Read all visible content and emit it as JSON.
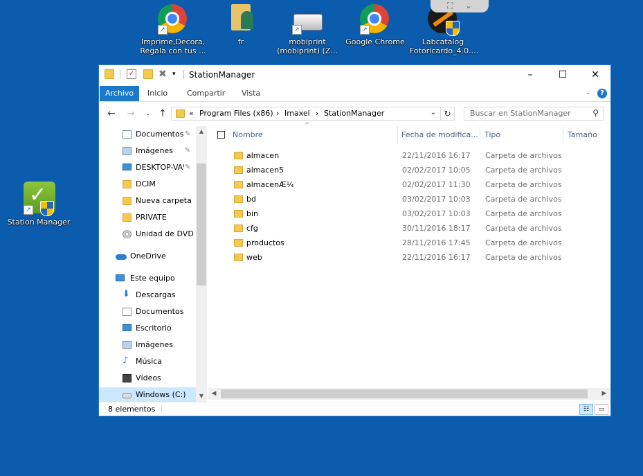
{
  "colors": {
    "desktop_bg": "#0b5cad",
    "accent": "#1979ca",
    "selection": "#cce8ff"
  },
  "desktop_icons": [
    {
      "label": "Imprime,Decora, Regala con tus ...",
      "icon": "chrome-icon"
    },
    {
      "label": "fr",
      "icon": "user-folder-icon"
    },
    {
      "label": "mobiprint (mobiprint) (Z...",
      "icon": "network-drive-icon"
    },
    {
      "label": "Google Chrome",
      "icon": "chrome-icon"
    },
    {
      "label": "Labcatalog Fotoricardo_4.0....",
      "icon": "labcatalog-icon"
    },
    {
      "label": "Station Manager",
      "icon": "station-manager-icon"
    }
  ],
  "window": {
    "title": "StationManager",
    "controls": {
      "minimize": "–",
      "maximize": "☐",
      "close": "✕"
    },
    "ribbon_tabs": [
      "Archivo",
      "Inicio",
      "Compartir",
      "Vista"
    ],
    "address": {
      "overflow": "«",
      "segments": [
        "Program Files (x86)",
        "Imaxel",
        "StationManager"
      ],
      "separator": "›"
    },
    "search_placeholder": "Buscar en StationManager",
    "nav_items": [
      {
        "label": "Documentos",
        "icon": "documents-icon",
        "pinned": true
      },
      {
        "label": "Imágenes",
        "icon": "pictures-icon",
        "pinned": true
      },
      {
        "label": "DESKTOP-VA\\",
        "icon": "computer-icon",
        "pinned": true
      },
      {
        "label": "DCIM",
        "icon": "folder-icon",
        "pinned": false
      },
      {
        "label": "Nueva carpeta",
        "icon": "folder-icon",
        "pinned": false
      },
      {
        "label": "PRIVATE",
        "icon": "folder-icon",
        "pinned": false
      },
      {
        "label": "Unidad de DVD R",
        "icon": "dvd-icon",
        "pinned": false
      },
      {
        "label": "OneDrive",
        "icon": "onedrive-icon",
        "pinned": false
      },
      {
        "label": "Este equipo",
        "icon": "this-pc-icon",
        "pinned": false
      },
      {
        "label": "Descargas",
        "icon": "downloads-icon",
        "pinned": false
      },
      {
        "label": "Documentos",
        "icon": "documents-icon",
        "pinned": false
      },
      {
        "label": "Escritorio",
        "icon": "desktop-icon",
        "pinned": false
      },
      {
        "label": "Imágenes",
        "icon": "pictures-icon",
        "pinned": false
      },
      {
        "label": "Música",
        "icon": "music-icon",
        "pinned": false
      },
      {
        "label": "Vídeos",
        "icon": "videos-icon",
        "pinned": false
      },
      {
        "label": "Windows (C:)",
        "icon": "drive-icon",
        "pinned": false
      }
    ],
    "columns": [
      "Nombre",
      "Fecha de modifica...",
      "Tipo",
      "Tamaño"
    ],
    "files": [
      {
        "name": "almacen",
        "date": "22/11/2016 16:17",
        "type": "Carpeta de archivos"
      },
      {
        "name": "almacen5",
        "date": "02/02/2017 10:05",
        "type": "Carpeta de archivos"
      },
      {
        "name": "almacenÆ¼",
        "date": "02/02/2017 11:30",
        "type": "Carpeta de archivos"
      },
      {
        "name": "bd",
        "date": "03/02/2017 10:03",
        "type": "Carpeta de archivos"
      },
      {
        "name": "bin",
        "date": "03/02/2017 10:03",
        "type": "Carpeta de archivos"
      },
      {
        "name": "cfg",
        "date": "30/11/2016 18:17",
        "type": "Carpeta de archivos"
      },
      {
        "name": "productos",
        "date": "28/11/2016 17:45",
        "type": "Carpeta de archivos"
      },
      {
        "name": "web",
        "date": "22/11/2016 16:17",
        "type": "Carpeta de archivos"
      }
    ],
    "status": "8 elementos"
  }
}
